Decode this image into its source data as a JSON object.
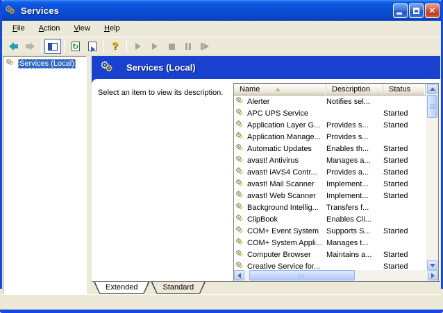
{
  "window": {
    "title": "Services",
    "controls": {
      "minimize": "minimize",
      "maximize": "maximize",
      "close": "close",
      "close_glyph": "×"
    }
  },
  "menu": {
    "items": [
      {
        "hot": "F",
        "rest": "ile"
      },
      {
        "hot": "A",
        "rest": "ction"
      },
      {
        "hot": "V",
        "rest": "iew"
      },
      {
        "hot": "H",
        "rest": "elp"
      }
    ]
  },
  "toolbar": {
    "icons": [
      "back",
      "forward",
      "show-hide-console-tree",
      "refresh",
      "export-list",
      "help",
      "start-service",
      "resume-service",
      "stop-service",
      "pause-service",
      "restart-service"
    ]
  },
  "tree": {
    "items": [
      {
        "label": "Services (Local)",
        "selected": true
      }
    ]
  },
  "pane": {
    "header_title": "Services (Local)",
    "description_prompt": "Select an item to view its description."
  },
  "list": {
    "columns": [
      {
        "label": "Name",
        "sort": "asc"
      },
      {
        "label": "Description",
        "sort": ""
      },
      {
        "label": "Status",
        "sort": ""
      }
    ],
    "rows": [
      {
        "name": "Alerter",
        "description": "Notifies sel...",
        "status": ""
      },
      {
        "name": "APC UPS Service",
        "description": "",
        "status": "Started"
      },
      {
        "name": "Application Layer G...",
        "description": "Provides s...",
        "status": "Started"
      },
      {
        "name": "Application Manage...",
        "description": "Provides s...",
        "status": ""
      },
      {
        "name": "Automatic Updates",
        "description": "Enables th...",
        "status": "Started"
      },
      {
        "name": "avast! Antivirus",
        "description": "Manages a...",
        "status": "Started"
      },
      {
        "name": "avast! iAVS4 Contr...",
        "description": "Provides a...",
        "status": "Started"
      },
      {
        "name": "avast! Mail Scanner",
        "description": "Implement...",
        "status": "Started"
      },
      {
        "name": "avast! Web Scanner",
        "description": "Implement...",
        "status": "Started"
      },
      {
        "name": "Background Intellig...",
        "description": "Transfers f...",
        "status": ""
      },
      {
        "name": "ClipBook",
        "description": "Enables Cli...",
        "status": ""
      },
      {
        "name": "COM+ Event System",
        "description": "Supports S...",
        "status": "Started"
      },
      {
        "name": "COM+ System Appli...",
        "description": "Manages t...",
        "status": ""
      },
      {
        "name": "Computer Browser",
        "description": "Maintains a...",
        "status": "Started"
      },
      {
        "name": "Creative Service for...",
        "description": "",
        "status": "Started"
      }
    ]
  },
  "tabs": [
    {
      "label": "Extended",
      "active": true
    },
    {
      "label": "Standard",
      "active": false
    }
  ],
  "colors": {
    "titlebar_blue": "#0c53dd",
    "window_border": "#1548dc",
    "pane_header_blue": "#1941d0",
    "selection_blue": "#316ac5",
    "chrome_beige": "#ece9d8",
    "close_red": "#e2572f"
  }
}
